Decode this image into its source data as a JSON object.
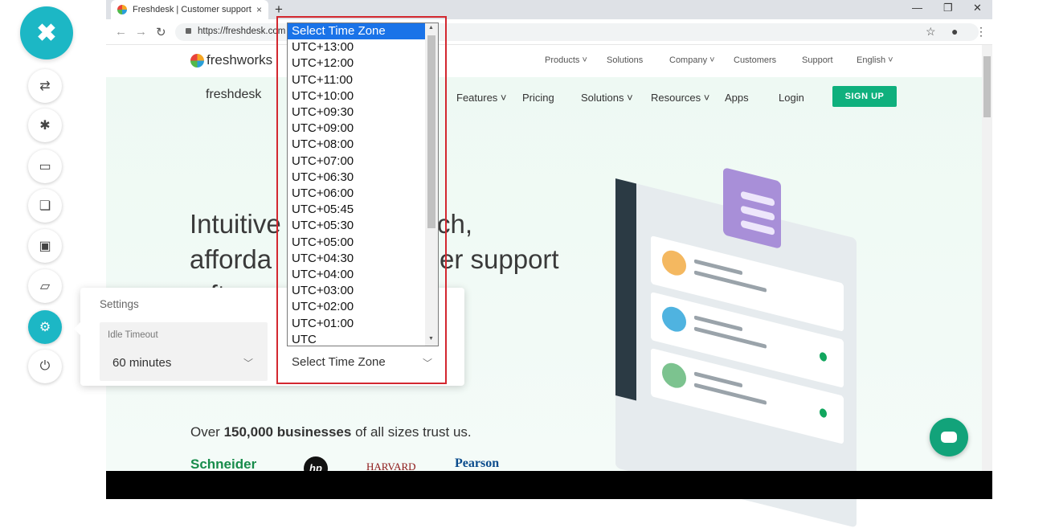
{
  "browser": {
    "tab_title": "Freshdesk | Customer support so",
    "tab_close": "×",
    "new_tab": "+",
    "url": "https://freshdesk.com",
    "window_controls": [
      "—",
      "❐",
      "✕"
    ]
  },
  "site": {
    "brand": "freshworks",
    "product": "freshdesk",
    "top_nav": [
      "Products",
      "Solutions",
      "Company",
      "Customers",
      "Support",
      "English"
    ],
    "main_nav": [
      "Features",
      "Pricing",
      "Solutions",
      "Resources",
      "Apps",
      "Login"
    ],
    "signup": "SIGN UP",
    "headline_line1": "Intuitive",
    "headline_line1_end": "ch,",
    "headline_line2": "afforda",
    "headline_line2_end": "er support",
    "headline_line3": "s  ft",
    "trust_pre": "Over ",
    "trust_bold": "150,000 businesses",
    "trust_post": " of all sizes trust us.",
    "logos": [
      "Schneider",
      "hp",
      "HARVARD",
      "Pearson"
    ]
  },
  "sidebar": {
    "close_glyph": "✖",
    "buttons": [
      {
        "name": "sync-icon",
        "glyph": "⇄"
      },
      {
        "name": "bug-icon",
        "glyph": "✱"
      },
      {
        "name": "video-icon",
        "glyph": "▭"
      },
      {
        "name": "copy-icon",
        "glyph": "❏"
      },
      {
        "name": "screen-icon",
        "glyph": "▣"
      },
      {
        "name": "folder-icon",
        "glyph": "▱"
      },
      {
        "name": "gear-icon",
        "glyph": "⚙"
      },
      {
        "name": "power-icon",
        "glyph": "⏻"
      }
    ]
  },
  "settings": {
    "title": "Settings",
    "idle_label": "Idle Timeout",
    "idle_value": "60 minutes",
    "timezone_value": "Select Time Zone"
  },
  "timezone_dropdown": {
    "options": [
      "Select Time Zone",
      "UTC+13:00",
      "UTC+12:00",
      "UTC+11:00",
      "UTC+10:00",
      "UTC+09:30",
      "UTC+09:00",
      "UTC+08:00",
      "UTC+07:00",
      "UTC+06:30",
      "UTC+06:00",
      "UTC+05:45",
      "UTC+05:30",
      "UTC+05:00",
      "UTC+04:30",
      "UTC+04:00",
      "UTC+03:00",
      "UTC+02:00",
      "UTC+01:00",
      "UTC"
    ],
    "selected_index": 0
  },
  "colors": {
    "accent": "#1cb7c5",
    "highlight": "#d3272f",
    "selected_option": "#1a73e8",
    "signup": "#0fb07d"
  }
}
